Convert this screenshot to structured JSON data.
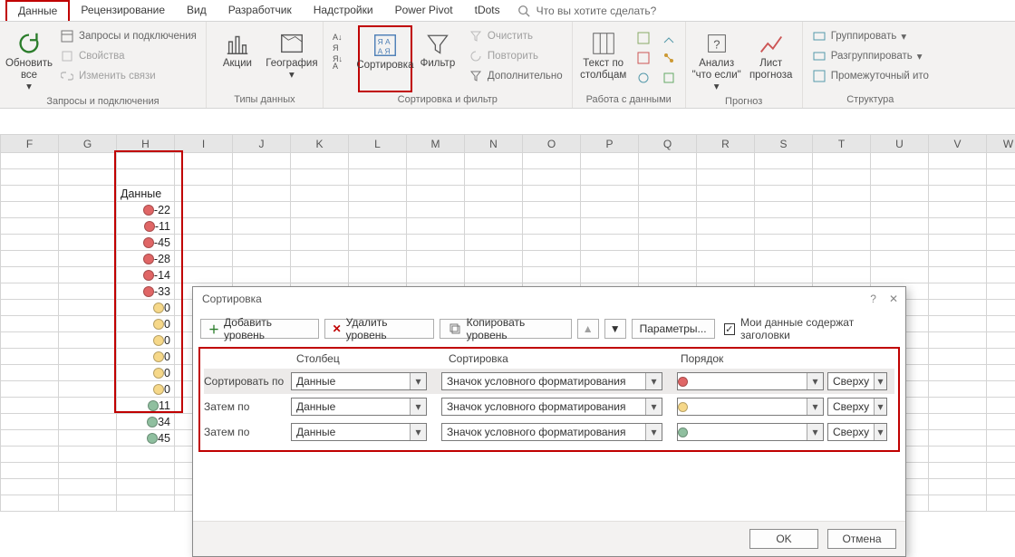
{
  "tabs": {
    "items": [
      "Данные",
      "Рецензирование",
      "Вид",
      "Разработчик",
      "Надстройки",
      "Power Pivot",
      "tDots"
    ],
    "active": "Данные",
    "tell_me": "Что вы хотите сделать?"
  },
  "ribbon": {
    "g1": {
      "label": "Запросы и подключения",
      "refresh": "Обновить все",
      "queries": "Запросы и подключения",
      "props": "Свойства",
      "links": "Изменить связи"
    },
    "g2": {
      "label": "Типы данных",
      "stocks": "Акции",
      "geo": "География"
    },
    "g3": {
      "label": "Сортировка и фильтр",
      "sort_btn": "Сортировка",
      "filter": "Фильтр",
      "clear": "Очистить",
      "reapply": "Повторить",
      "advanced": "Дополнительно"
    },
    "g4": {
      "label": "Работа с данными",
      "t2c": "Текст по столбцам"
    },
    "g5": {
      "label": "Прогноз",
      "whatif": "Анализ \"что если\"",
      "forecast": "Лист прогноза"
    },
    "g6": {
      "label": "Структура",
      "group": "Группировать",
      "ungroup": "Разгруппировать",
      "subtotal": "Промежуточный ито"
    }
  },
  "columns": [
    "F",
    "G",
    "H",
    "I",
    "J",
    "K",
    "L",
    "M",
    "N",
    "O",
    "P",
    "Q",
    "R",
    "S",
    "T",
    "U",
    "V",
    "W"
  ],
  "data_header": "Данные",
  "data_rows": [
    {
      "v": "-22",
      "c": "red"
    },
    {
      "v": "-11",
      "c": "red"
    },
    {
      "v": "-45",
      "c": "red"
    },
    {
      "v": "-28",
      "c": "red"
    },
    {
      "v": "-14",
      "c": "red"
    },
    {
      "v": "-33",
      "c": "red"
    },
    {
      "v": "0",
      "c": "yel"
    },
    {
      "v": "0",
      "c": "yel"
    },
    {
      "v": "0",
      "c": "yel"
    },
    {
      "v": "0",
      "c": "yel"
    },
    {
      "v": "0",
      "c": "yel"
    },
    {
      "v": "0",
      "c": "yel"
    },
    {
      "v": "11",
      "c": "grn"
    },
    {
      "v": "34",
      "c": "grn"
    },
    {
      "v": "45",
      "c": "grn"
    }
  ],
  "dialog": {
    "title": "Сортировка",
    "add": "Добавить уровень",
    "del": "Удалить уровень",
    "copy": "Копировать уровень",
    "options": "Параметры...",
    "mydata": "Мои данные содержат заголовки",
    "hdr_col": "Столбец",
    "hdr_sort": "Сортировка",
    "hdr_order": "Порядок",
    "sort_by": "Сортировать по",
    "then_by": "Затем по",
    "col_value": "Данные",
    "sort_value": "Значок условного форматирования",
    "side": "Сверху",
    "ok": "OK",
    "cancel": "Отмена",
    "levels": [
      {
        "label": "sort_by",
        "ball": "#e06666"
      },
      {
        "label": "then_by",
        "ball": "#f6d889"
      },
      {
        "label": "then_by",
        "ball": "#8fbf9f"
      }
    ]
  }
}
